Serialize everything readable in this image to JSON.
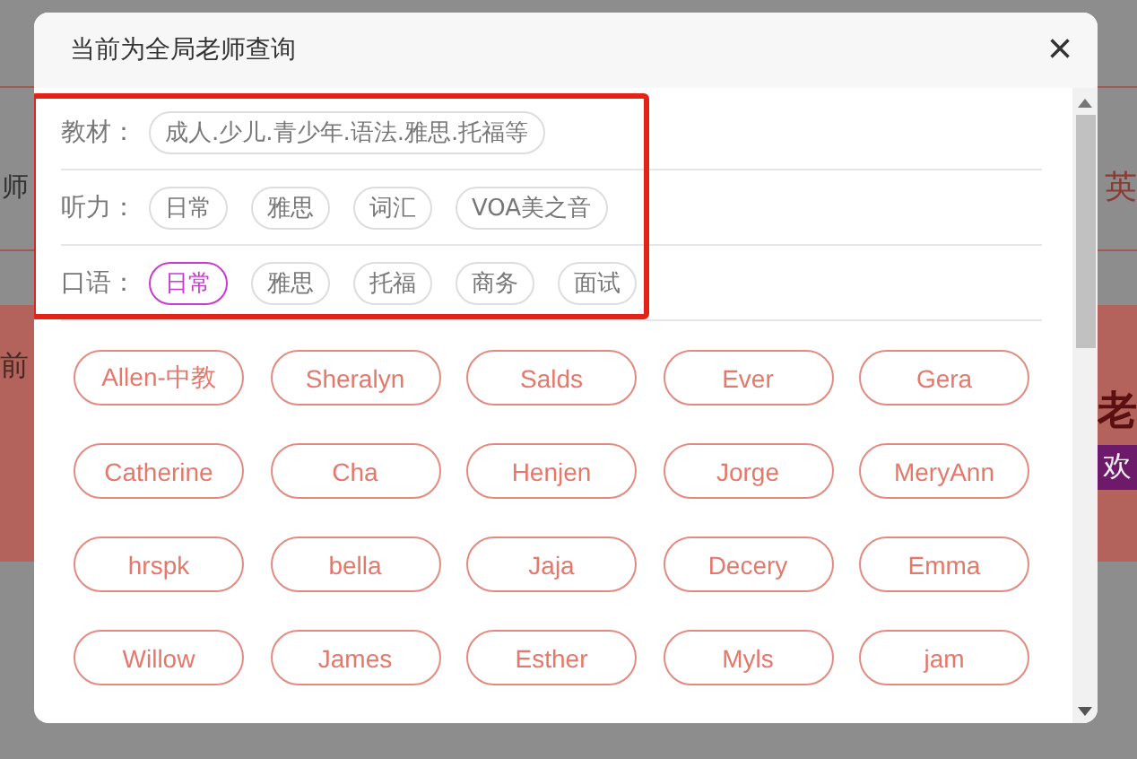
{
  "background": {
    "left_text": "师",
    "right_text": "英",
    "band_left_text": "前",
    "band_right_text": "老",
    "badge_text": "欢"
  },
  "dialog": {
    "title": "当前为全局老师查询",
    "close": "×",
    "filters": [
      {
        "label": "教材：",
        "options": [
          {
            "label": "成人.少儿.青少年.语法.雅思.托福等",
            "selected": false
          }
        ]
      },
      {
        "label": "听力：",
        "options": [
          {
            "label": "日常",
            "selected": false
          },
          {
            "label": "雅思",
            "selected": false
          },
          {
            "label": "词汇",
            "selected": false
          },
          {
            "label": "VOA美之音",
            "selected": false
          }
        ]
      },
      {
        "label": "口语：",
        "options": [
          {
            "label": "日常",
            "selected": true
          },
          {
            "label": "雅思",
            "selected": false
          },
          {
            "label": "托福",
            "selected": false
          },
          {
            "label": "商务",
            "selected": false
          },
          {
            "label": "面试",
            "selected": false
          }
        ]
      }
    ],
    "teachers": [
      "Allen-中教",
      "Sheralyn",
      "Salds",
      "Ever",
      "Gera",
      "Catherine",
      "Cha",
      "Henjen",
      "Jorge",
      "MeryAnn",
      "hrspk",
      "bella",
      "Jaja",
      "Decery",
      "Emma",
      "Willow",
      "James",
      "Esther",
      "Myls",
      "jam"
    ]
  }
}
